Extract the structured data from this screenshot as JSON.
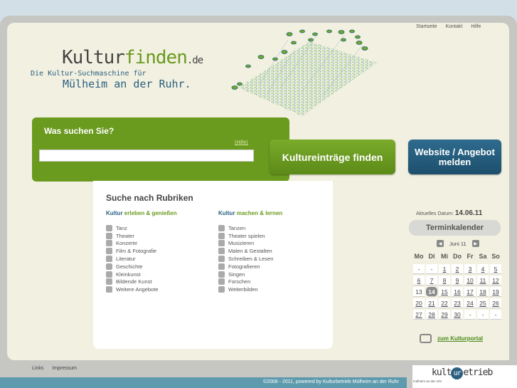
{
  "topnav": [
    "Startseite",
    "Kontakt",
    "Hilfe"
  ],
  "logo": {
    "title_main": "Kultur",
    "title_accent": "finden",
    "title_tld": ".de",
    "subtitle": "Die Kultur-Suchmaschine für",
    "city": "Mülheim an der Ruhr."
  },
  "search": {
    "label": "Was suchen Sie?",
    "help": "(Hilfe)",
    "value": ""
  },
  "buttons": {
    "find": "Kultureinträge finden",
    "report_line1": "Website / Angebot",
    "report_line2": "melden"
  },
  "categories": {
    "title": "Suche nach Rubriken",
    "left": {
      "head_prefix": "Kultur",
      "head_rest": " erleben & genießen",
      "items": [
        "Tanz",
        "Theater",
        "Konzerte",
        "Film & Fotografie",
        "Literatur",
        "Geschichte",
        "Kleinkunst",
        "Bildende Kunst",
        "Weitere Angebote"
      ]
    },
    "right": {
      "head_prefix": "Kultur",
      "head_rest": " machen & lernen",
      "items": [
        "Tanzen",
        "Theater spielen",
        "Musizieren",
        "Malen & Gestalten",
        "Schreiben & Lesen",
        "Fotografieren",
        "Singen",
        "Forschen",
        "Weiterbilden"
      ]
    }
  },
  "calendar": {
    "date_label": "Aktuelles Datum:",
    "date_value": "14.06.11",
    "title": "Terminkalender",
    "month": "Juni 11",
    "prev": "◀",
    "next": "▶",
    "weekdays": [
      "Mo",
      "Di",
      "Mi",
      "Do",
      "Fr",
      "Sa",
      "So"
    ],
    "days": [
      "-",
      "-",
      "1",
      "2",
      "3",
      "4",
      "5",
      "6",
      "7",
      "8",
      "9",
      "10",
      "11",
      "12",
      "13",
      "14",
      "15",
      "16",
      "17",
      "18",
      "19",
      "20",
      "21",
      "22",
      "23",
      "24",
      "25",
      "26",
      "27",
      "28",
      "29",
      "30",
      "-",
      "-",
      "-"
    ],
    "today": "14",
    "linked_days": [
      "1",
      "2",
      "3",
      "4",
      "5",
      "6",
      "7",
      "8",
      "9",
      "10",
      "11",
      "12",
      "15",
      "16",
      "17",
      "18",
      "19",
      "20",
      "21",
      "22",
      "23",
      "24",
      "25",
      "26",
      "27",
      "28",
      "29",
      "30"
    ]
  },
  "portal_link": "zum Kulturportal",
  "footer": {
    "links": [
      "Links",
      "Impressum"
    ],
    "copyright": "©2008 - 2011, powered by Kulturbetrieb Mülheim an der Ruhr"
  },
  "brand": {
    "pre": "kult",
    "mark": "ur",
    "post": "etrieb",
    "sub": "mülheim an der ruhr"
  },
  "colors": {
    "green": "#6a9a1e",
    "blue": "#2a5f80",
    "footer_bar": "#5e9aad"
  }
}
